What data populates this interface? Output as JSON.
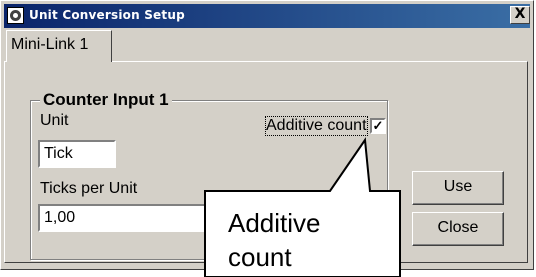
{
  "window": {
    "title": "Unit Conversion Setup",
    "close_symbol": "X"
  },
  "tabs": [
    {
      "label": "Mini-Link 1"
    }
  ],
  "group": {
    "title": "Counter Input 1",
    "unit_label": "Unit",
    "unit_value": "Tick",
    "additive_label": "Additive count",
    "additive_checked": true,
    "additive_mark": "✓",
    "ticks_label": "Ticks per Unit",
    "ticks_value": "1,00"
  },
  "buttons": {
    "use": "Use",
    "close": "Close"
  },
  "callout": {
    "line1": "Additive",
    "line2": "count"
  }
}
